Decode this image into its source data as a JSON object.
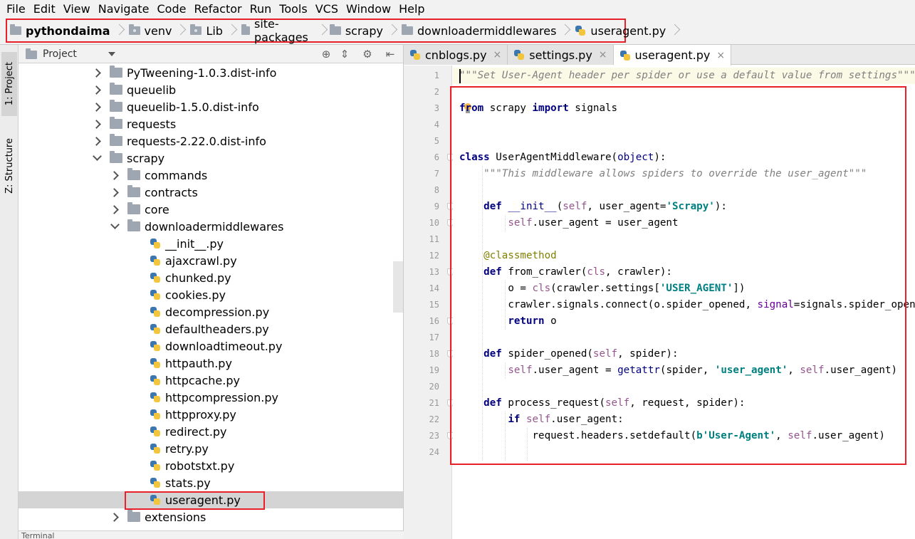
{
  "menu": [
    "File",
    "Edit",
    "View",
    "Navigate",
    "Code",
    "Refactor",
    "Run",
    "Tools",
    "VCS",
    "Window",
    "Help"
  ],
  "breadcrumbs": [
    "pythondaima",
    "venv",
    "Lib",
    "site-packages",
    "scrapy",
    "downloadermiddlewares",
    "useragent.py"
  ],
  "toolstrip": {
    "project_tab": "1: Project",
    "structure_tab": "Z: Structure"
  },
  "project_panel": {
    "title": "Project"
  },
  "tree": [
    {
      "label": "PyTweening-1.0.3.dist-info",
      "type": "folder",
      "state": "collapsed",
      "level": 0
    },
    {
      "label": "queuelib",
      "type": "folder",
      "state": "collapsed",
      "level": 0
    },
    {
      "label": "queuelib-1.5.0.dist-info",
      "type": "folder",
      "state": "collapsed",
      "level": 0
    },
    {
      "label": "requests",
      "type": "folder",
      "state": "collapsed",
      "level": 0
    },
    {
      "label": "requests-2.22.0.dist-info",
      "type": "folder",
      "state": "collapsed",
      "level": 0
    },
    {
      "label": "scrapy",
      "type": "folder",
      "state": "expanded",
      "level": 0
    },
    {
      "label": "commands",
      "type": "folder",
      "state": "collapsed",
      "level": 1
    },
    {
      "label": "contracts",
      "type": "folder",
      "state": "collapsed",
      "level": 1
    },
    {
      "label": "core",
      "type": "folder",
      "state": "collapsed",
      "level": 1
    },
    {
      "label": "downloadermiddlewares",
      "type": "folder",
      "state": "expanded",
      "level": 1
    },
    {
      "label": "__init__.py",
      "type": "file",
      "level": 2
    },
    {
      "label": "ajaxcrawl.py",
      "type": "file",
      "level": 2
    },
    {
      "label": "chunked.py",
      "type": "file",
      "level": 2
    },
    {
      "label": "cookies.py",
      "type": "file",
      "level": 2
    },
    {
      "label": "decompression.py",
      "type": "file",
      "level": 2
    },
    {
      "label": "defaultheaders.py",
      "type": "file",
      "level": 2
    },
    {
      "label": "downloadtimeout.py",
      "type": "file",
      "level": 2
    },
    {
      "label": "httpauth.py",
      "type": "file",
      "level": 2
    },
    {
      "label": "httpcache.py",
      "type": "file",
      "level": 2
    },
    {
      "label": "httpcompression.py",
      "type": "file",
      "level": 2
    },
    {
      "label": "httpproxy.py",
      "type": "file",
      "level": 2
    },
    {
      "label": "redirect.py",
      "type": "file",
      "level": 2
    },
    {
      "label": "retry.py",
      "type": "file",
      "level": 2
    },
    {
      "label": "robotstxt.py",
      "type": "file",
      "level": 2
    },
    {
      "label": "stats.py",
      "type": "file",
      "level": 2
    },
    {
      "label": "useragent.py",
      "type": "file",
      "level": 2,
      "selected": true
    },
    {
      "label": "extensions",
      "type": "folder",
      "state": "collapsed",
      "level": 1
    }
  ],
  "bottom_strip": "Terminal",
  "editor": {
    "tabs": [
      {
        "label": "cnblogs.py",
        "active": false
      },
      {
        "label": "settings.py",
        "active": false
      },
      {
        "label": "useragent.py",
        "active": true
      }
    ],
    "close_glyph": "×",
    "line_numbers": [
      "1",
      "2",
      "3",
      "4",
      "5",
      "6",
      "7",
      "8",
      "9",
      "10",
      "11",
      "12",
      "13",
      "14",
      "15",
      "16",
      "17",
      "18",
      "19",
      "20",
      "21",
      "22",
      "23",
      "24"
    ],
    "code": [
      [
        {
          "t": "\"\"\"Set User-Agent header per spider or use a default value from settings\"\"\"",
          "c": "doc"
        }
      ],
      [],
      [
        {
          "t": "from",
          "c": "kw"
        },
        {
          "t": " scrapy "
        },
        {
          "t": "import",
          "c": "kw"
        },
        {
          "t": " signals"
        }
      ],
      [],
      [],
      [
        {
          "t": "class",
          "c": "kw"
        },
        {
          "t": " UserAgentMiddleware("
        },
        {
          "t": "object",
          "c": "sp"
        },
        {
          "t": "):"
        }
      ],
      [
        {
          "t": "    "
        },
        {
          "t": "\"\"\"This middleware allows spiders to override the user_agent\"\"\"",
          "c": "doc"
        }
      ],
      [],
      [
        {
          "t": "    "
        },
        {
          "t": "def",
          "c": "kw"
        },
        {
          "t": " "
        },
        {
          "t": "__init__",
          "c": "sp"
        },
        {
          "t": "("
        },
        {
          "t": "self",
          "c": "self"
        },
        {
          "t": ", user_agent="
        },
        {
          "t": "'Scrapy'",
          "c": "str"
        },
        {
          "t": "):"
        }
      ],
      [
        {
          "t": "        "
        },
        {
          "t": "self",
          "c": "self"
        },
        {
          "t": ".user_agent = user_agent"
        }
      ],
      [],
      [
        {
          "t": "    "
        },
        {
          "t": "@classmethod",
          "c": "dec"
        }
      ],
      [
        {
          "t": "    "
        },
        {
          "t": "def",
          "c": "kw"
        },
        {
          "t": " from_crawler("
        },
        {
          "t": "cls",
          "c": "self"
        },
        {
          "t": ", crawler):"
        }
      ],
      [
        {
          "t": "        o = "
        },
        {
          "t": "cls",
          "c": "self"
        },
        {
          "t": "(crawler.settings["
        },
        {
          "t": "'USER_AGENT'",
          "c": "str"
        },
        {
          "t": "])"
        }
      ],
      [
        {
          "t": "        crawler.signals.connect(o.spider_opened, "
        },
        {
          "t": "signal",
          "c": "param"
        },
        {
          "t": "=signals.spider_opened)"
        }
      ],
      [
        {
          "t": "        "
        },
        {
          "t": "return",
          "c": "kw"
        },
        {
          "t": " o"
        }
      ],
      [],
      [
        {
          "t": "    "
        },
        {
          "t": "def",
          "c": "kw"
        },
        {
          "t": " spider_opened("
        },
        {
          "t": "self",
          "c": "self"
        },
        {
          "t": ", spider):"
        }
      ],
      [
        {
          "t": "        "
        },
        {
          "t": "self",
          "c": "self"
        },
        {
          "t": ".user_agent = "
        },
        {
          "t": "getattr",
          "c": "sp"
        },
        {
          "t": "(spider, "
        },
        {
          "t": "'user_agent'",
          "c": "str"
        },
        {
          "t": ", "
        },
        {
          "t": "self",
          "c": "self"
        },
        {
          "t": ".user_agent)"
        }
      ],
      [],
      [
        {
          "t": "    "
        },
        {
          "t": "def",
          "c": "kw"
        },
        {
          "t": " process_request("
        },
        {
          "t": "self",
          "c": "self"
        },
        {
          "t": ", request, spider):"
        }
      ],
      [
        {
          "t": "        "
        },
        {
          "t": "if",
          "c": "kw"
        },
        {
          "t": " "
        },
        {
          "t": "self",
          "c": "self"
        },
        {
          "t": ".user_agent:"
        }
      ],
      [
        {
          "t": "            request.headers.setdefault("
        },
        {
          "t": "b'User-Agent'",
          "c": "str"
        },
        {
          "t": ", "
        },
        {
          "t": "self",
          "c": "self"
        },
        {
          "t": ".user_agent)"
        }
      ],
      []
    ]
  },
  "colors": {
    "highlight_box": "#e8202a",
    "keyword": "#000080",
    "string": "#008080",
    "self": "#94558d",
    "docstring": "#808080",
    "decorator": "#808000"
  }
}
